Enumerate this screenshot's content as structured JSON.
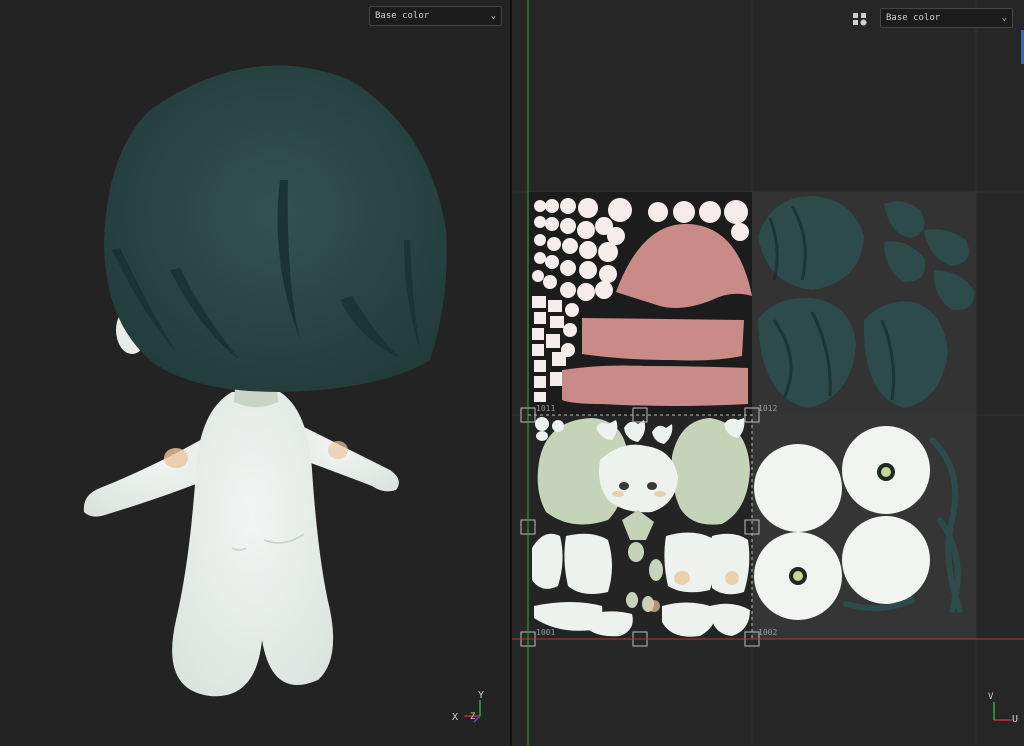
{
  "viewport_3d": {
    "channel_dropdown": {
      "value": "Base color"
    },
    "axes": {
      "x": "X",
      "y": "Y",
      "z": "Z"
    }
  },
  "viewport_uv": {
    "channel_dropdown": {
      "value": "Base color"
    },
    "axes": {
      "v": "V",
      "u": "U"
    },
    "udim_tiles": {
      "t1001": "1001",
      "t1002": "1002",
      "t1011": "1011",
      "t1012": "1012"
    }
  },
  "colors": {
    "hair": "#2c4b4a",
    "skin": "#e8ece9",
    "blush": "#eac7a0",
    "mouth": "#c98b87",
    "face_green": "#c5d3b9",
    "u_axis_red": "#b8332f",
    "v_axis_green": "#2fa84a"
  }
}
